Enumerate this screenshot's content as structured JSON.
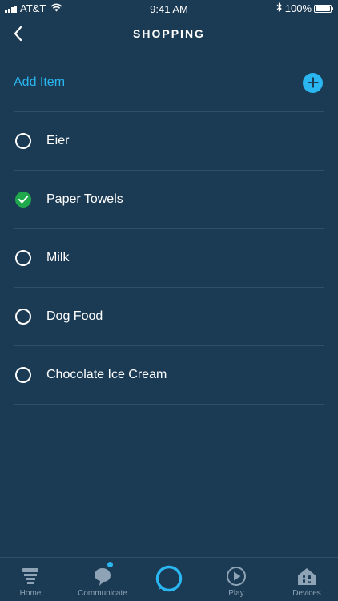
{
  "status_bar": {
    "carrier": "AT&T",
    "time": "9:41 AM",
    "battery": "100%"
  },
  "header": {
    "title": "SHOPPING"
  },
  "add_item": {
    "label": "Add Item"
  },
  "list": {
    "items": [
      {
        "label": "Eier",
        "checked": false
      },
      {
        "label": "Paper Towels",
        "checked": true
      },
      {
        "label": "Milk",
        "checked": false
      },
      {
        "label": "Dog Food",
        "checked": false
      },
      {
        "label": "Chocolate Ice Cream",
        "checked": false
      }
    ]
  },
  "bottom_nav": {
    "home": "Home",
    "communicate": "Communicate",
    "play": "Play",
    "devices": "Devices"
  },
  "colors": {
    "background": "#1b3a54",
    "accent": "#2ab6f0",
    "checked": "#20a84d",
    "nav_inactive": "#8ea3b5"
  }
}
